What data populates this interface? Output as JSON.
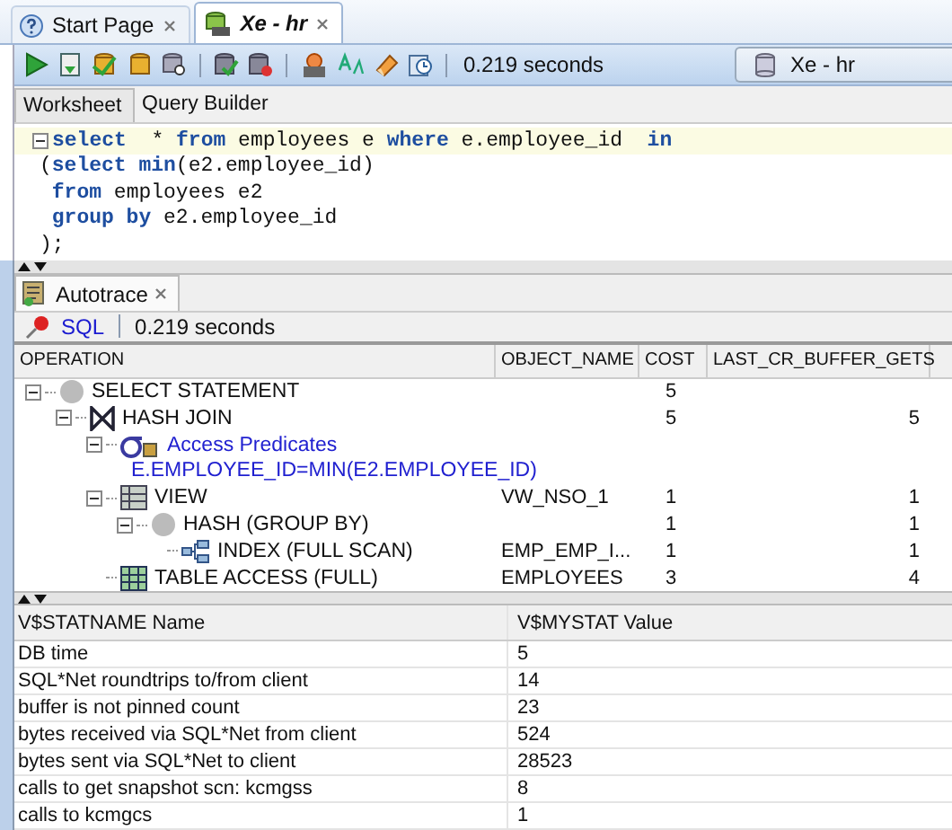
{
  "tabs": [
    {
      "label": "Start Page",
      "kind": "start",
      "selected": false
    },
    {
      "label": "Xe - hr",
      "kind": "worksheet",
      "selected": true
    }
  ],
  "toolbar": {
    "elapsed": "0.219 seconds",
    "connection": "Xe - hr"
  },
  "subtabs": [
    {
      "label": "Worksheet",
      "selected": true
    },
    {
      "label": "Query Builder",
      "selected": false
    }
  ],
  "editor": {
    "lines": [
      [
        {
          "text": "select",
          "kind": "keyword"
        },
        {
          "text": "  * ",
          "kind": "plain"
        },
        {
          "text": "from",
          "kind": "keyword"
        },
        {
          "text": " employees e ",
          "kind": "plain"
        },
        {
          "text": "where",
          "kind": "keyword"
        },
        {
          "text": " e.employee_id  ",
          "kind": "plain"
        },
        {
          "text": "in",
          "kind": "keyword"
        }
      ],
      [
        {
          "text": "(",
          "kind": "plain"
        },
        {
          "text": "select min",
          "kind": "keyword"
        },
        {
          "text": "(e2.employee_id)",
          "kind": "plain"
        }
      ],
      [
        {
          "text": " from",
          "kind": "keyword"
        },
        {
          "text": " employees e2",
          "kind": "plain"
        }
      ],
      [
        {
          "text": " group by",
          "kind": "keyword"
        },
        {
          "text": " e2.employee_id",
          "kind": "plain"
        }
      ],
      [
        {
          "text": ");",
          "kind": "plain"
        }
      ]
    ]
  },
  "autotrace": {
    "tab": {
      "label": "Autotrace",
      "selected": true
    },
    "link": "SQL",
    "elapsed": "0.219 seconds",
    "columns": [
      "OPERATION",
      "OBJECT_NAME",
      "COST",
      "LAST_CR_BUFFER_GETS"
    ],
    "rows": [
      {
        "kind": "statement",
        "operation": "SELECT STATEMENT",
        "cost": "5",
        "expanded": true,
        "children": [
          {
            "kind": "join",
            "operation": "HASH JOIN",
            "cost": "5",
            "gets": "5",
            "expanded": true,
            "children": [
              {
                "kind": "filter",
                "operation": "Access Predicates",
                "expanded": true,
                "children": [
                  {
                    "kind": "predicate",
                    "operation": "E.EMPLOYEE_ID=MIN(E2.EMPLOYEE_ID)"
                  }
                ]
              },
              {
                "kind": "view",
                "operation": "VIEW",
                "object": "VW_NSO_1",
                "cost": "1",
                "gets": "1",
                "expanded": true,
                "children": [
                  {
                    "kind": "statement",
                    "operation": "HASH (GROUP BY)",
                    "cost": "1",
                    "gets": "1",
                    "expanded": true,
                    "children": [
                      {
                        "kind": "index",
                        "operation": "INDEX (FULL SCAN)",
                        "object": "EMP_EMP_I...",
                        "cost": "1",
                        "gets": "1"
                      }
                    ]
                  }
                ]
              },
              {
                "kind": "table",
                "operation": "TABLE ACCESS (FULL)",
                "object": "EMPLOYEES",
                "cost": "3",
                "gets": "4"
              }
            ]
          }
        ]
      }
    ]
  },
  "stats": {
    "columns": [
      "V$STATNAME Name",
      "V$MYSTAT Value"
    ],
    "rows": [
      [
        "DB time",
        "5"
      ],
      [
        "SQL*Net roundtrips to/from client",
        "14"
      ],
      [
        "buffer is not pinned count",
        "23"
      ],
      [
        "bytes received via SQL*Net from client",
        "524"
      ],
      [
        "bytes sent via SQL*Net to client",
        "28523"
      ],
      [
        "calls to get snapshot scn: kcmgss",
        "8"
      ],
      [
        "calls to kcmgcs",
        "1"
      ]
    ]
  }
}
